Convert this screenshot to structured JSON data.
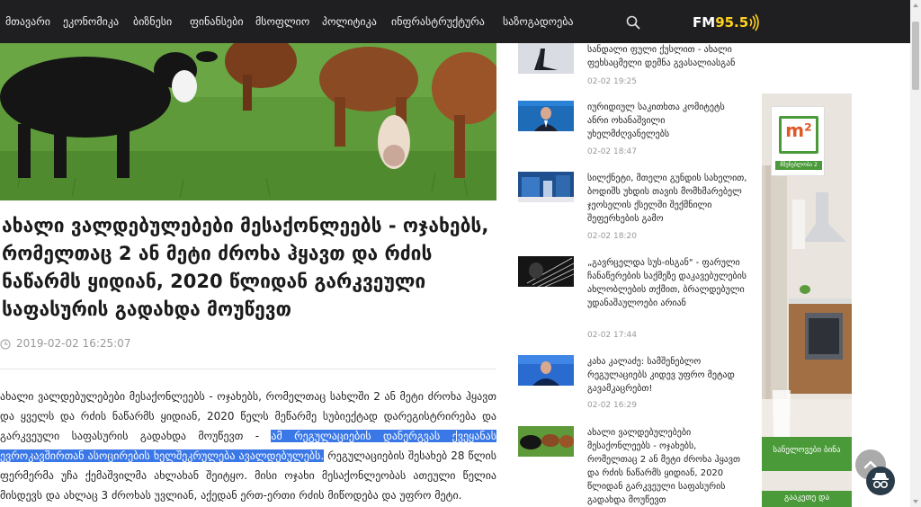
{
  "nav": {
    "items": [
      "მთავარი",
      "ეკონომიკა",
      "ბიზნესი",
      "ფინანსები",
      "მსოფლიო",
      "პოლიტიკა",
      "ინფრასტრუქტურა",
      "საზოგადოება"
    ],
    "logo_fm": "FM",
    "logo_num": "95.5"
  },
  "article": {
    "title": "ახალი ვალდებულებები მესაქონლეებს - ოჯახებს, რომელთაც 2 ან მეტი ძროხა ჰყავთ და რძის ნაწარმს ყიდიან, 2020 წლიდან გარკვეული საფასურის გადახდა მოუწევთ",
    "date": "2019-02-02 16:25:07",
    "body_before": "ახალი ვალდებულებები მესაქონლეებს - ოჯახებს, რომელთაც სახლში 2 ან მეტი ძროხა ჰყავთ და ყველს და რძის ნაწარმს ყიდიან, 2020 წელს მეწარმე სუბიექტად დარეგისტრირება და გარკვეული საფასურის გადახდა მოუწევთ - ",
    "body_highlight": "ამ რეგულაციების დანერგვას ქვეყანას ევროკავშირთან ასოცირების ხელშეკრულება ავალდებულებს.",
    "body_after": " რეგულაციების შესახებ 28 წლის ფერმერმა უჩა ქემაშვილმა ახლახან შეიტყო. მისი ოჯახი მესაქონლეობას ათეული წელია მისდევს და ახლაც 3 ძროხას უვლიან, აქედან ერთ-ერთი რძის მიწოდება და უფრო მეტი."
  },
  "sidebar": {
    "news": [
      {
        "title": "სანდალი ფული ქუსლით - ახალი ფეხსაცმელი დემნა გვასალიასგან",
        "date": "02-02 19:25"
      },
      {
        "title": "იურიდიულ საკითხთა კომიტეტს ანრი ოხანაშვილი უხელმძღვანელებს",
        "date": "02-02 18:47"
      },
      {
        "title": "სილქნეტი, მთელი გუნდის სახელით, ბოდიშს უხდის თავის მომხმარებელ ჯეოსელის ქსელში შექმნილი შეფერხების გამო",
        "date": "02-02 18:20"
      },
      {
        "title": "„გავრცელდა სუს-ისგან\" - ფარული ჩანაწერების საქმეზე დაკავებულების ახლობლების თქმით, ბრალდებული უდანაშაულოები არიან",
        "date": "02-02 17:44"
      },
      {
        "title": "კახა კალაძე: სამშენებლო რეგულაციებს კიდევ უფრო მეტად გავამკაცრებთ!",
        "date": "02-02 16:29"
      },
      {
        "title": "ახალი ვალდებულებები მესაქონლეებს - ოჯახებს, რომელთაც 2 ან მეტი ძროხა ჰყავთ და რძის ნაწარმს ყიდიან, 2020 წლიდან გარკვეული საფასურის გადახდა მოუწევთ",
        "date": ""
      }
    ]
  },
  "ad": {
    "logo": "m²",
    "logo_sub": "მშენებლობა 2",
    "caption": "სანელოვები ბინა",
    "bottom": "გააკეთე და"
  },
  "colors": {
    "nav_bg": "#1f1f21",
    "highlight": "#3b78e7",
    "ad_green": "#4a9a3a",
    "logo_yellow": "#ffd21e"
  }
}
